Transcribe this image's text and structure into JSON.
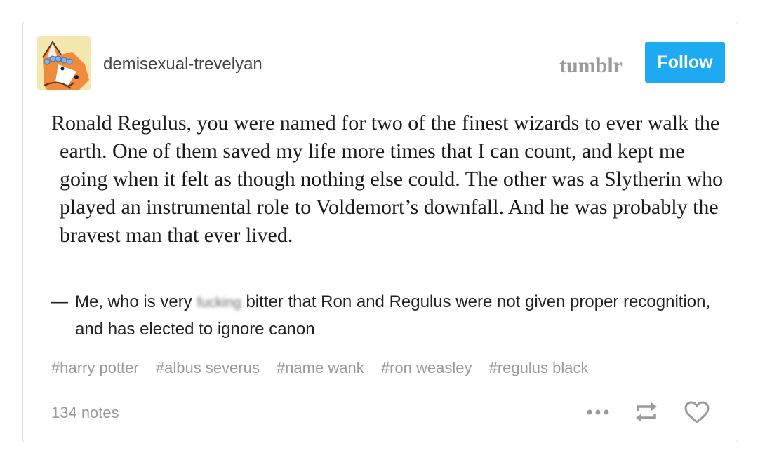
{
  "post": {
    "username": "demisexual-trevelyan",
    "brand": "tumblr",
    "follow_label": "Follow",
    "quote": "Ronald Regulus, you were named for two of the finest wizards to ever walk the earth. One of them saved my life more times that I can count, and kept me going when it felt as though nothing else could. The other was a Slytherin who played an instrumental role to Voldemort’s downfall. And he was probably the bravest man that ever lived.",
    "source": {
      "dash": "—",
      "before": "Me, who is very",
      "blurred": "fucking",
      "after": "bitter that Ron and Regulus were not given proper recognition, and has elected to ignore canon"
    },
    "tags": [
      "#harry potter",
      "#albus severus",
      "#name wank",
      "#ron weasley",
      "#regulus black"
    ],
    "notes": "134 notes"
  },
  "icons": {
    "avatar": "fox-avatar",
    "more": "more-dots-icon",
    "reblog": "reblog-icon",
    "like": "heart-icon"
  },
  "colors": {
    "follow_bg": "#1eaaf1",
    "brand": "#9b9b9b",
    "tag_text": "#9a9a9a",
    "border": "#dcdcdc"
  }
}
